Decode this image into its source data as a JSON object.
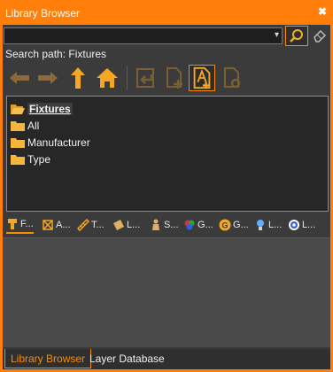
{
  "window": {
    "title": "Library Browser",
    "close_glyph": "✖"
  },
  "search": {
    "value": "",
    "dropdown_glyph": "▾"
  },
  "path": {
    "label": "Search path: Fixtures"
  },
  "toolbar": {
    "buttons": [
      {
        "icon": "back-arrow-icon",
        "enabled": false
      },
      {
        "icon": "forward-arrow-icon",
        "enabled": false
      },
      {
        "icon": "up-arrow-icon",
        "enabled": true
      },
      {
        "icon": "home-icon",
        "enabled": true
      },
      {
        "icon": "import-icon",
        "enabled": false
      },
      {
        "icon": "add-file-icon",
        "enabled": false
      },
      {
        "icon": "add-symbol-icon",
        "enabled": true
      },
      {
        "icon": "symbol-settings-icon",
        "enabled": false
      }
    ]
  },
  "tree": {
    "items": [
      {
        "label": "Fixtures",
        "open": true,
        "selected": true
      },
      {
        "label": "All"
      },
      {
        "label": "Manufacturer"
      },
      {
        "label": "Type"
      }
    ]
  },
  "tabs": [
    {
      "label": "F...",
      "icon": "fixture-icon",
      "active": true
    },
    {
      "label": "A...",
      "icon": "accessory-icon"
    },
    {
      "label": "T...",
      "icon": "truss-icon"
    },
    {
      "label": "L...",
      "icon": "label-icon"
    },
    {
      "label": "S...",
      "icon": "stage-icon"
    },
    {
      "label": "G...",
      "icon": "gobo-icon"
    },
    {
      "label": "G...",
      "icon": "g-circle-icon"
    },
    {
      "label": "L...",
      "icon": "lamp-icon"
    },
    {
      "label": "L...",
      "icon": "lens-icon"
    }
  ],
  "bottom_tabs": [
    {
      "label": "Library Browser",
      "active": true
    },
    {
      "label": "Layer Database",
      "active": false
    }
  ],
  "colors": {
    "accent": "#ff8a00",
    "background": "#3b3b3b",
    "folder": "#f5b43a"
  }
}
